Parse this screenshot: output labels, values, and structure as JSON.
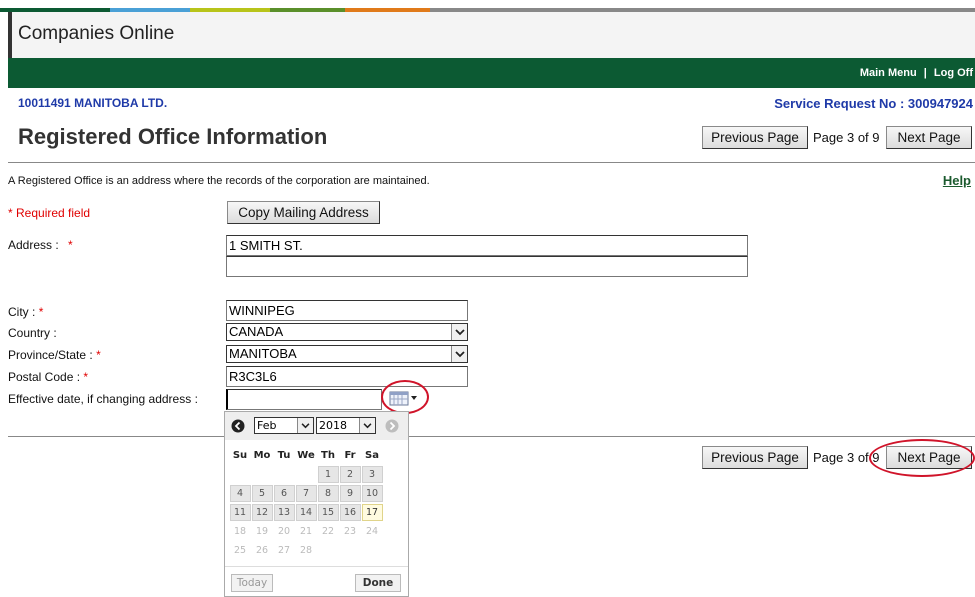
{
  "app": {
    "title": "Companies Online"
  },
  "stripe_colors": [
    "#0c5a33",
    "#4aa0d6",
    "#b8c41a",
    "#5a8f2a",
    "#e07a1a",
    "#888888"
  ],
  "topnav": {
    "main_menu": "Main Menu",
    "separator": "|",
    "log_off": "Log Off"
  },
  "company": {
    "name": "10011491 MANITOBA LTD."
  },
  "service_request": {
    "text": "Service Request No : 300947924"
  },
  "page": {
    "title": "Registered Office Information",
    "description": "A Registered Office is an address where the records of the corporation are maintained.",
    "help": "Help",
    "required_note": "* Required field",
    "indicator": "Page 3 of 9"
  },
  "nav_buttons": {
    "previous": "Previous Page",
    "next": "Next Page"
  },
  "copy_button": "Copy Mailing Address",
  "form": {
    "address_label": "Address :",
    "address_line1": "1 SMITH ST.",
    "address_line2": "",
    "city_label": "City :",
    "city": "WINNIPEG",
    "country_label": "Country :",
    "country": "CANADA",
    "province_label": "Province/State :",
    "province": "MANITOBA",
    "postal_label": "Postal Code :",
    "postal": "R3C3L6",
    "effective_label": "Effective date, if changing address :",
    "effective_value": "",
    "asterisk": "*"
  },
  "datepicker": {
    "month": "Feb",
    "year": "2018",
    "weekdays": [
      "Su",
      "Mo",
      "Tu",
      "We",
      "Th",
      "Fr",
      "Sa"
    ],
    "weeks": [
      [
        "",
        "",
        "",
        "",
        "1",
        "2",
        "3"
      ],
      [
        "4",
        "5",
        "6",
        "7",
        "8",
        "9",
        "10"
      ],
      [
        "11",
        "12",
        "13",
        "14",
        "15",
        "16",
        "17"
      ],
      [
        "18",
        "19",
        "20",
        "21",
        "22",
        "23",
        "24"
      ],
      [
        "25",
        "26",
        "27",
        "28",
        "",
        "",
        ""
      ]
    ],
    "today_day": "17",
    "selectable_through": "17",
    "today_button": "Today",
    "done_button": "Done"
  },
  "highlight_color": "#d0142a"
}
